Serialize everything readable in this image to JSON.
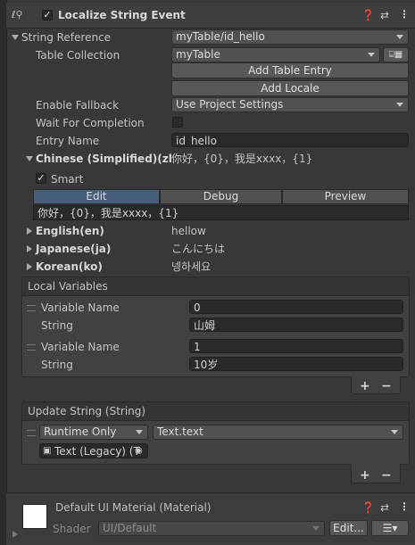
{
  "header": {
    "enabled": true,
    "title": "Localize String Event",
    "icons": [
      "help-icon",
      "preset-icon",
      "menu-icon"
    ]
  },
  "string_reference": {
    "label": "String Reference",
    "value": "myTable/id_hello",
    "table_collection_label": "Table Collection",
    "table_collection_value": "myTable",
    "add_table_entry": "Add Table Entry",
    "add_locale": "Add Locale",
    "enable_fallback_label": "Enable Fallback",
    "enable_fallback_value": "Use Project Settings",
    "wait_for_completion_label": "Wait For Completion",
    "wait_for_completion_checked": false,
    "entry_name_label": "Entry Name",
    "entry_name_value": "id_hello"
  },
  "locales": {
    "chinese": {
      "label": "Chinese (Simplified)(zl",
      "preview": "你好，{0}，我是xxxx，{1}",
      "smart_label": "Smart",
      "smart_checked": true,
      "tabs": [
        "Edit",
        "Debug",
        "Preview"
      ],
      "active_tab": "Edit",
      "value": "你好，{0}，我是xxxx，{1}"
    },
    "others": [
      {
        "label": "English(en)",
        "value": "hellow"
      },
      {
        "label": "Japanese(ja)",
        "value": "こんにちは"
      },
      {
        "label": "Korean(ko)",
        "value": "넹하세요"
      }
    ]
  },
  "local_variables": {
    "title": "Local Variables",
    "items": [
      {
        "name_label": "Variable Name",
        "name_value": "0",
        "type_label": "String",
        "type_value": "山姆"
      },
      {
        "name_label": "Variable Name",
        "name_value": "1",
        "type_label": "String",
        "type_value": "10岁"
      }
    ],
    "add": "+",
    "remove": "−"
  },
  "update_string": {
    "title": "Update String (String)",
    "runtime": "Runtime Only",
    "function": "Text.text",
    "target": "Text (Legacy) (T",
    "add": "+",
    "remove": "−"
  },
  "material": {
    "title": "Default UI Material (Material)",
    "shader_label": "Shader",
    "shader_value": "UI/Default",
    "edit": "Edit..."
  },
  "colors": {
    "background": "#383838",
    "active_tab": "#46607c"
  }
}
